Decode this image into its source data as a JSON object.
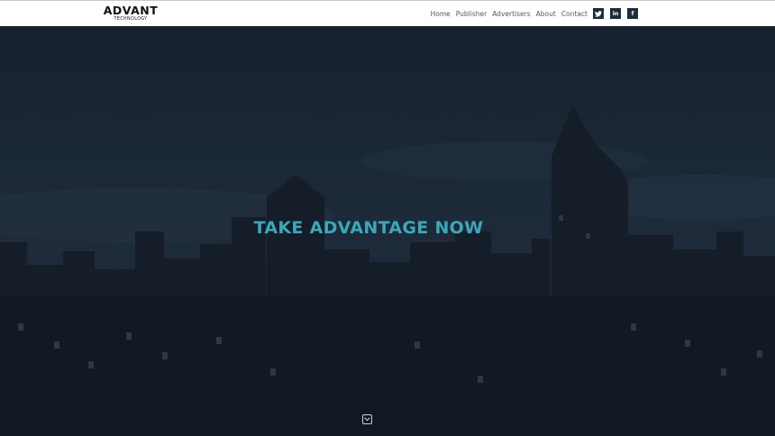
{
  "brand": {
    "name": "ADVANT",
    "tagline": "TECHNOLOGY"
  },
  "nav": {
    "items": [
      {
        "label": "Home"
      },
      {
        "label": "Publisher"
      },
      {
        "label": "Advertisers"
      },
      {
        "label": "About"
      },
      {
        "label": "Contact"
      }
    ]
  },
  "social": {
    "twitter": {
      "icon": "twitter-icon",
      "glyph": "t"
    },
    "linkedin": {
      "icon": "linkedin-icon",
      "glyph": "in"
    },
    "facebook": {
      "icon": "facebook-icon",
      "glyph": "f"
    }
  },
  "hero": {
    "headline": "TAKE ADVANTAGE NOW",
    "scroll_icon": "chevron-down-icon"
  },
  "colors": {
    "accent": "#39a9b8",
    "nav_background": "#ffffff",
    "social_button": "#1c2c3c",
    "hero_overlay": "#1b2837"
  }
}
